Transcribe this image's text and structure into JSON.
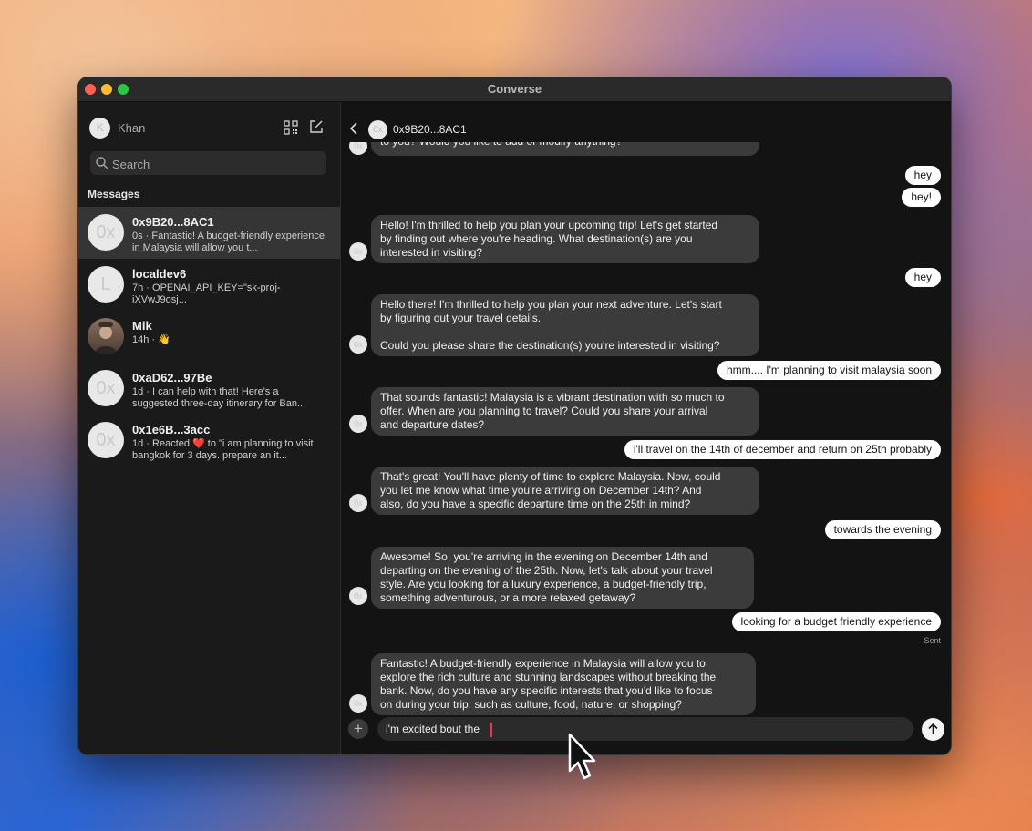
{
  "window": {
    "title": "Converse"
  },
  "sidebar": {
    "user": {
      "initial": "K",
      "name": "Khan"
    },
    "search": {
      "placeholder": "Search",
      "value": ""
    },
    "section_title": "Messages",
    "conversations": [
      {
        "initials": "0x",
        "name": "0x9B20...8AC1",
        "preview": "0s · Fantastic! A budget-friendly experience in Malaysia will allow you t..."
      },
      {
        "initials": "L",
        "name": "localdev6",
        "preview": "7h · OPENAI_API_KEY=\"sk-proj-iXVwJ9osj..."
      },
      {
        "initials": "",
        "name": "Mik",
        "preview": "14h · 👋"
      },
      {
        "initials": "0x",
        "name": "0xaD62...97Be",
        "preview": "1d · I can help with that! Here's a suggested three-day itinerary for Ban..."
      },
      {
        "initials": "0x",
        "name": "0x1e6B...3acc",
        "preview": "1d · Reacted ❤️ to \"i am planning to visit bangkok for 3 days. prepare an it..."
      }
    ]
  },
  "chat": {
    "header": {
      "initials": "0x",
      "name": "0x9B20...8AC1"
    },
    "avatar_initials": "0x",
    "messages": [
      {
        "dir": "in",
        "text": "to you? Would you like to add or modify anything?"
      },
      {
        "dir": "out",
        "text": "hey"
      },
      {
        "dir": "out",
        "text": "hey!"
      },
      {
        "dir": "in",
        "text": "Hello! I'm thrilled to help you plan your upcoming trip! Let's get started\nby finding out where you're heading. What destination(s) are you\ninterested in visiting?"
      },
      {
        "dir": "out",
        "text": "hey"
      },
      {
        "dir": "in",
        "text": "Hello there! I'm thrilled to help you plan your next adventure. Let's start\nby figuring out your travel details.\n\nCould you please share the destination(s) you're interested in visiting?"
      },
      {
        "dir": "out",
        "text": "hmm.... I'm planning to visit malaysia soon"
      },
      {
        "dir": "in",
        "text": "That sounds fantastic! Malaysia is a vibrant destination with so much to\noffer. When are you planning to travel? Could you share your arrival\nand departure dates?"
      },
      {
        "dir": "out",
        "text": "i'll travel on the 14th of december and return on 25th probably"
      },
      {
        "dir": "in",
        "text": "That's great! You'll have plenty of time to explore Malaysia. Now, could\nyou let me know what time you're arriving on December 14th? And\nalso, do you have a specific departure time on the 25th in mind?"
      },
      {
        "dir": "out",
        "text": "towards the evening"
      },
      {
        "dir": "in",
        "text": "Awesome! So, you're arriving in the evening on December 14th and\ndeparting on the evening of the 25th. Now, let's talk about your travel\nstyle. Are you looking for a luxury experience, a budget-friendly trip,\nsomething adventurous, or a more relaxed getaway?"
      },
      {
        "dir": "out",
        "text": "looking for a budget friendly experience"
      },
      {
        "dir": "in",
        "text": "Fantastic! A budget-friendly experience in Malaysia will allow you to\nexplore the rich culture and stunning landscapes without breaking the\nbank. Now, do you have any specific interests that you'd like to focus\non during your trip, such as culture, food, nature, or shopping?"
      }
    ],
    "sent_label": "Sent",
    "composer": {
      "plus_label": "+",
      "value": "i'm excited bout the "
    }
  }
}
